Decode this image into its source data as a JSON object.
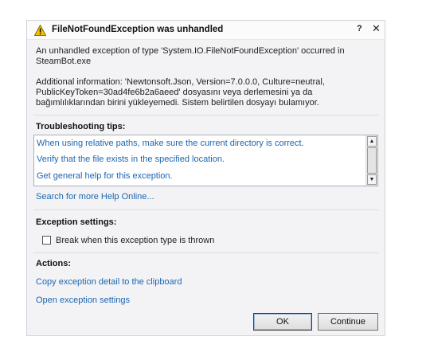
{
  "dialog": {
    "title": "FileNotFoundException was unhandled",
    "help_button": "?",
    "close_button": "✕",
    "description": "An unhandled exception of type 'System.IO.FileNotFoundException' occurred in SteamBot.exe",
    "additional_info": "Additional information: 'Newtonsoft.Json, Version=7.0.0.0, Culture=neutral, PublicKeyToken=30ad4fe6b2a6aeed' dosyasını veya derlemesini ya da bağımlılıklarından birini yükleyemedi. Sistem belirtilen dosyayı bulamıyor."
  },
  "troubleshooting": {
    "heading": "Troubleshooting tips:",
    "tips": [
      "When using relative paths, make sure the current directory is correct.",
      "Verify that the file exists in the specified location.",
      "Get general help for this exception."
    ],
    "search_link": "Search for more Help Online..."
  },
  "exception_settings": {
    "heading": "Exception settings:",
    "checkbox_label": "Break when this exception type is thrown",
    "checked": false
  },
  "actions": {
    "heading": "Actions:",
    "links": [
      "Copy exception detail to the clipboard",
      "Open exception settings"
    ]
  },
  "buttons": {
    "ok": "OK",
    "continue": "Continue"
  },
  "colors": {
    "link": "#1b66b1",
    "warning": "#f2c200"
  },
  "icons": {
    "title": "warning-icon",
    "scroll_up": "scroll-up-arrow-icon",
    "scroll_down": "scroll-down-arrow-icon"
  }
}
